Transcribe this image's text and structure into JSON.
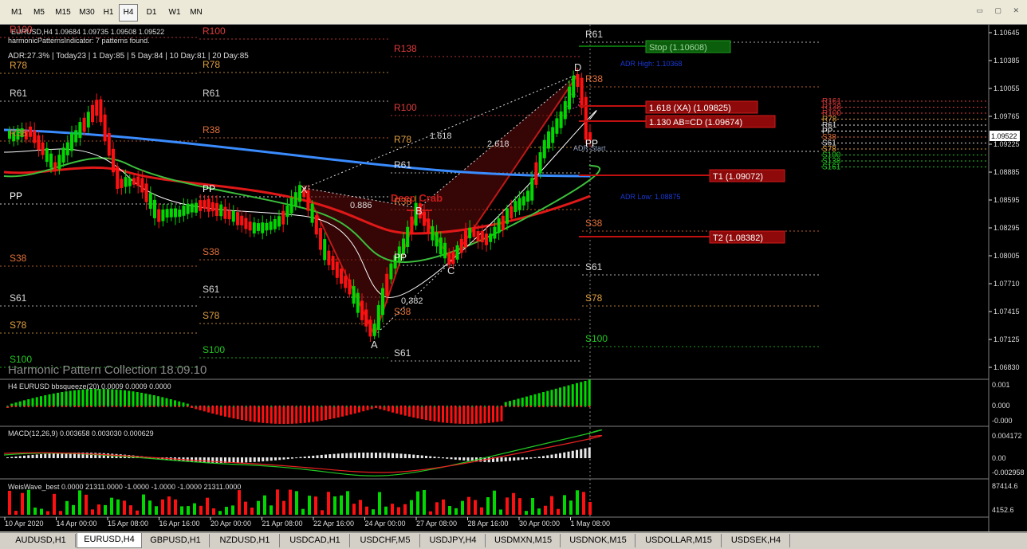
{
  "toolbar": {
    "timeframes": [
      "M1",
      "M5",
      "M15",
      "M30",
      "H1",
      "H4",
      "D1",
      "W1",
      "MN"
    ],
    "active": "H4"
  },
  "main": {
    "header_symbol": "EURUSD,H4  1.09684 1.09735 1.09508 1.09522",
    "header_indicator": "harmonicPatternsIndicator: 7 patterns found.",
    "adr_line": "ADR:27.3%  |  Today23  |  1 Day:85  |  5 Day:84  |  10 Day:81  |  20 Day:85",
    "watermark": "Harmonic Pattern Collection 18.09.10",
    "pattern_name": "Deep Crab",
    "points": {
      "x": "X",
      "a": "A",
      "b": "B",
      "c": "C",
      "d": "D"
    },
    "ratios": {
      "xb": "0.886",
      "ac": "0.382",
      "bd": "2.618",
      "xd": "1.618"
    },
    "boxes": {
      "stop": "Stop  (1.10608)",
      "xa": "1.618 (XA) (1.09825)",
      "abcd": "1.130 AB=CD (1.09674)",
      "t1": "T1  (1.09072)",
      "t2": "T2  (1.08382)"
    },
    "adr_high": "ADR High: 1.10368",
    "adr_low": "ADR Low: 1.08875",
    "adr_start": "ADR Start",
    "current_price": "1.09522",
    "pivot_labels": {
      "r100": "R100",
      "r78": "R78",
      "r61": "R61",
      "r38": "R38",
      "r138": "R138",
      "pp": "PP",
      "s38": "S38",
      "s61": "S61",
      "s78": "S78",
      "s100": "S100"
    },
    "right_pivot_stack": [
      "R161",
      "R138",
      "R100",
      "R78",
      "R61",
      "PP",
      "S38",
      "S61",
      "S78",
      "S100",
      "S138",
      "S161"
    ]
  },
  "price_axis": [
    "1.10645",
    "1.10385",
    "1.10055",
    "1.09765",
    "1.09225",
    "1.08885",
    "1.08595",
    "1.08295",
    "1.08005",
    "1.07710",
    "1.07415",
    "1.07125",
    "1.06830"
  ],
  "panels": {
    "bbsqueeze": {
      "title": "H4 EURUSD bbsqueeze(20) 0.0009 0.0009 0.0000",
      "axis": [
        "0.001",
        "0.000",
        "-0.000"
      ]
    },
    "macd": {
      "title": "MACD(12,26,9) 0.003658 0.003030 0.000629",
      "axis": [
        "0.004172",
        "0.00",
        "-0.002958"
      ]
    },
    "weis": {
      "title": "WeisWave_best 0.0000 21311.0000 -1.0000 -1.0000 -1.0000 21311.0000",
      "axis": [
        "87414.6",
        "4152.6"
      ]
    }
  },
  "time_axis": [
    "10 Apr 2020",
    "14 Apr 00:00",
    "15 Apr 08:00",
    "16 Apr 16:00",
    "20 Apr 00:00",
    "21 Apr 08:00",
    "22 Apr 16:00",
    "24 Apr 00:00",
    "27 Apr 08:00",
    "28 Apr 16:00",
    "30 Apr 00:00",
    "1 May 08:00"
  ],
  "symbol_tabs": [
    "AUDUSD,H1",
    "EURUSD,H4",
    "GBPUSD,H1",
    "NZDUSD,H1",
    "USDCAD,H1",
    "USDCHF,M5",
    "USDJPY,H4",
    "USDMXN,M15",
    "USDNOK,M15",
    "USDOLLAR,M15",
    "USDSEK,H4"
  ],
  "active_tab": "EURUSD,H4",
  "colors": {
    "bull": "#00d800",
    "bear": "#ff1010",
    "ma_blue": "#3a8cff",
    "ma_red": "#e01818",
    "ma_green": "#3cbf3c",
    "pattern": "#b01010"
  }
}
